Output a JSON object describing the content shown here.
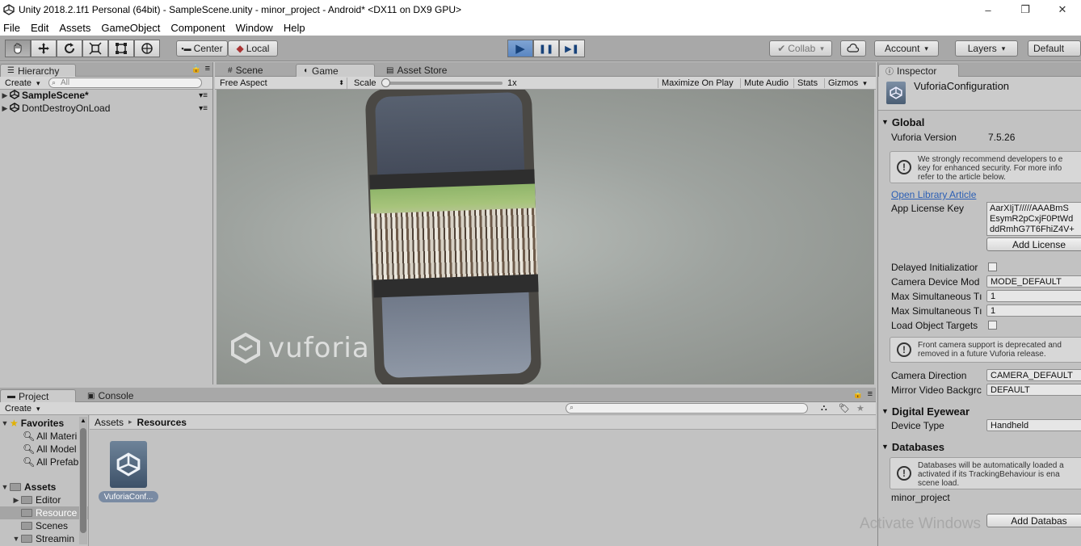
{
  "window": {
    "title": "Unity 2018.2.1f1 Personal (64bit) - SampleScene.unity - minor_project - Android* <DX11 on DX9 GPU>",
    "minimize": "–",
    "maximize": "❐",
    "close": "✕"
  },
  "menu": [
    "File",
    "Edit",
    "Assets",
    "GameObject",
    "Component",
    "Window",
    "Help"
  ],
  "toolbar": {
    "tools": [
      "hand-icon",
      "move-icon",
      "rotate-icon",
      "scale-icon",
      "rect-icon",
      "transform-icon"
    ],
    "pivot": "Center",
    "space": "Local",
    "play": "▶",
    "pause": "❚❚",
    "step": "▶❚",
    "collab": "Collab",
    "account": "Account",
    "layers": "Layers",
    "layout": "Default"
  },
  "hierarchy": {
    "tab": "Hierarchy",
    "create": "Create",
    "search_placeholder": "All",
    "items": [
      "SampleScene*",
      "DontDestroyOnLoad"
    ]
  },
  "scene_tabs": {
    "scene": "Scene",
    "game": "Game",
    "asset_store": "Asset Store"
  },
  "game_bar": {
    "aspect": "Free Aspect",
    "scale_label": "Scale",
    "scale_value": "1x",
    "scale_fraction": 0.0,
    "maximize": "Maximize On Play",
    "mute": "Mute Audio",
    "stats": "Stats",
    "gizmos": "Gizmos"
  },
  "game_view": {
    "watermark": "vuforia"
  },
  "project": {
    "tab": "Project",
    "console_tab": "Console",
    "create": "Create",
    "favorites_label": "Favorites",
    "favorites": [
      "All Materi",
      "All Model",
      "All Prefab"
    ],
    "assets_label": "Assets",
    "folders": [
      "Editor",
      "Resource",
      "Scenes",
      "Streamin"
    ],
    "breadcrumb_root": "Assets",
    "breadcrumb_sep": "▸",
    "breadcrumb_current": "Resources",
    "asset_name": "VuforiaConf..."
  },
  "inspector": {
    "tab": "Inspector",
    "object_name": "VuforiaConfiguration",
    "global": "Global",
    "version_label": "Vuforia Version",
    "version_value": "7.5.26",
    "help1": [
      "We strongly recommend developers to e",
      "key for enhanced security. For more info",
      "refer to the article below."
    ],
    "link": "Open Library Article",
    "license_label": "App License Key",
    "license_lines": [
      "AarXIjT/////AAABmS",
      "EsymR2pCxjF0PtWd",
      "ddRmhG7T6FhiZ4V+"
    ],
    "add_license": "Add License",
    "delayed_label": "Delayed Initializatior",
    "camera_mode_label": "Camera Device Mod",
    "camera_mode_value": "MODE_DEFAULT",
    "max_img_label": "Max Simultaneous Tı",
    "max_img_value": "1",
    "max_obj_label": "Max Simultaneous Tı",
    "max_obj_value": "1",
    "load_targets_label": "Load Object Targets",
    "help2": [
      "Front camera support is deprecated and",
      "removed in a future Vuforia release."
    ],
    "cam_dir_label": "Camera Direction",
    "cam_dir_value": "CAMERA_DEFAULT",
    "mirror_label": "Mirror Video Backgrc",
    "mirror_value": "DEFAULT",
    "eyewear": "Digital Eyewear",
    "device_type_label": "Device Type",
    "device_type_value": "Handheld",
    "databases": "Databases",
    "help3": [
      "Databases will be automatically loaded a",
      "activated if its TrackingBehaviour is ena",
      "scene load."
    ],
    "db_name": "minor_project",
    "add_db": "Add Databas"
  },
  "overlay": {
    "activate": "Activate Windows"
  },
  "colors": {
    "play_active": "#5a86c2",
    "link": "#2b5fb5",
    "panel_bg": "#c2c2c2"
  }
}
